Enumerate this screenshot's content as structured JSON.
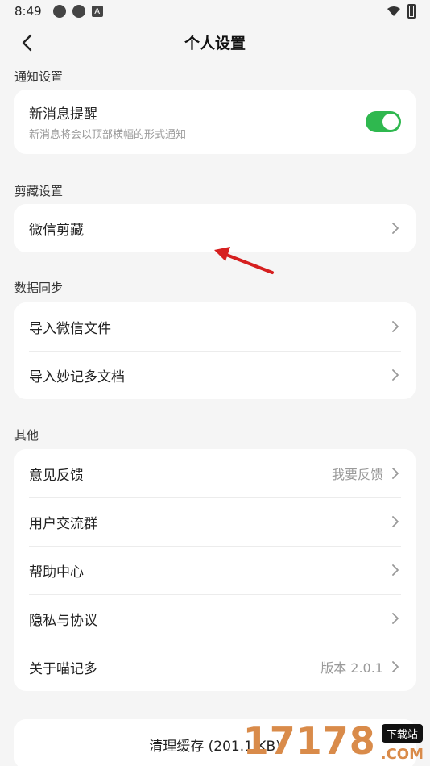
{
  "status_bar": {
    "time": "8:49",
    "a_badge": "A"
  },
  "header": {
    "title": "个人设置"
  },
  "sections": {
    "notify": {
      "title": "通知设置",
      "toggle_title": "新消息提醒",
      "toggle_sub": "新消息将会以顶部横幅的形式通知",
      "toggle_on": true
    },
    "clip": {
      "title": "剪藏设置",
      "items": [
        {
          "label": "微信剪藏"
        }
      ]
    },
    "sync": {
      "title": "数据同步",
      "items": [
        {
          "label": "导入微信文件"
        },
        {
          "label": "导入妙记多文档"
        }
      ]
    },
    "other": {
      "title": "其他",
      "items": [
        {
          "label": "意见反馈",
          "value": "我要反馈"
        },
        {
          "label": "用户交流群",
          "value": ""
        },
        {
          "label": "帮助中心",
          "value": ""
        },
        {
          "label": "隐私与协议",
          "value": ""
        },
        {
          "label": "关于喵记多",
          "value": "版本 2.0.1"
        }
      ]
    }
  },
  "clear_cache": {
    "label": "清理缓存 (201.1 KB)"
  },
  "watermark": {
    "main": "17178",
    "tag": "下载站",
    "com": ".COM"
  },
  "colors": {
    "accent": "#2fb84f",
    "arrow": "#d62020"
  }
}
